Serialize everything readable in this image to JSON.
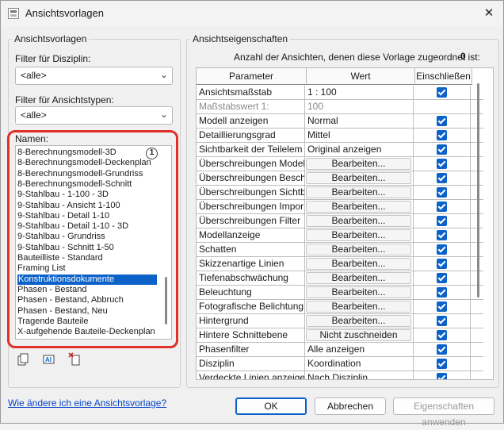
{
  "window": {
    "title": "Ansichtsvorlagen",
    "close": "✕"
  },
  "left": {
    "group_title": "Ansichtsvorlagen",
    "discipline_filter_label": "Filter für Disziplin:",
    "discipline_filter_value": "<alle>",
    "viewtype_filter_label": "Filter für Ansichtstypen:",
    "viewtype_filter_value": "<alle>",
    "names_label": "Namen:",
    "callout_number": "1",
    "names": [
      "8-Berechnungsmodell-3D",
      "8-Berechnungsmodell-Deckenplan",
      "8-Berechnungsmodell-Grundriss",
      "8-Berechnungsmodell-Schnitt",
      "9-Stahlbau - 1-100 - 3D",
      "9-Stahlbau - Ansicht 1-100",
      "9-Stahlbau - Detail 1-10",
      "9-Stahlbau - Detail 1-10 - 3D",
      "9-Stahlbau - Grundriss",
      "9-Stahlbau - Schnitt 1-50",
      "Bauteilliste - Standard",
      "Framing List",
      "Konstruktionsdokumente",
      "Phasen - Bestand",
      "Phasen - Bestand, Abbruch",
      "Phasen - Bestand, Neu",
      "Tragende Bauteile",
      "X-aufgehende Bauteile-Deckenplan"
    ],
    "selected_name": "Konstruktionsdokumente",
    "toolbar_icons": [
      "duplicate-icon",
      "rename-icon",
      "delete-icon"
    ]
  },
  "right": {
    "group_title": "Ansichtseigenschaften",
    "count_label": "Anzahl der Ansichten, denen diese Vorlage zugeordnet ist:",
    "count_value": "0",
    "headers": {
      "param": "Parameter",
      "value": "Wert",
      "include": "Einschließen"
    },
    "edit_label": "Bearbeiten...",
    "rows": [
      {
        "param": "Ansichtsmaßstab",
        "value": "1 : 100",
        "type": "text",
        "include": true
      },
      {
        "param": "Maßstabswert 1:",
        "value": "100",
        "type": "text",
        "grey": true,
        "include": null
      },
      {
        "param": "Modell anzeigen",
        "value": "Normal",
        "type": "text",
        "include": true
      },
      {
        "param": "Detaillierungsgrad",
        "value": "Mittel",
        "type": "text",
        "include": true
      },
      {
        "param": "Sichtbarkeit der Teilelem",
        "value": "Original anzeigen",
        "type": "text",
        "include": true
      },
      {
        "param": "Überschreibungen Model",
        "value": "Bearbeiten...",
        "type": "button",
        "include": true
      },
      {
        "param": "Überschreibungen Besch",
        "value": "Bearbeiten...",
        "type": "button",
        "include": true
      },
      {
        "param": "Überschreibungen Sichtb",
        "value": "Bearbeiten...",
        "type": "button",
        "include": true
      },
      {
        "param": "Überschreibungen Impor",
        "value": "Bearbeiten...",
        "type": "button",
        "include": true
      },
      {
        "param": "Überschreibungen Filter",
        "value": "Bearbeiten...",
        "type": "button",
        "include": true
      },
      {
        "param": "Modellanzeige",
        "value": "Bearbeiten...",
        "type": "button",
        "include": true
      },
      {
        "param": "Schatten",
        "value": "Bearbeiten...",
        "type": "button",
        "include": true
      },
      {
        "param": "Skizzenartige Linien",
        "value": "Bearbeiten...",
        "type": "button",
        "include": true
      },
      {
        "param": "Tiefenabschwächung",
        "value": "Bearbeiten...",
        "type": "button",
        "include": true
      },
      {
        "param": "Beleuchtung",
        "value": "Bearbeiten...",
        "type": "button",
        "include": true
      },
      {
        "param": "Fotografische Belichtung",
        "value": "Bearbeiten...",
        "type": "button",
        "include": true
      },
      {
        "param": "Hintergrund",
        "value": "Bearbeiten...",
        "type": "button",
        "include": true
      },
      {
        "param": "Hintere Schnittebene",
        "value": "Nicht zuschneiden",
        "type": "button",
        "include": true
      },
      {
        "param": "Phasenfilter",
        "value": "Alle anzeigen",
        "type": "text",
        "include": true
      },
      {
        "param": "Disziplin",
        "value": "Koordination",
        "type": "text",
        "include": true
      },
      {
        "param": "Verdeckte Linien anzeige",
        "value": "Nach Disziplin",
        "type": "text",
        "include": true
      }
    ]
  },
  "footer": {
    "help_link": "Wie ändere ich eine Ansichtsvorlage?",
    "ok": "OK",
    "cancel": "Abbrechen",
    "apply": "Eigenschaften anwenden"
  },
  "colors": {
    "accent": "#0c62c8",
    "highlight_border": "#e0302a"
  }
}
